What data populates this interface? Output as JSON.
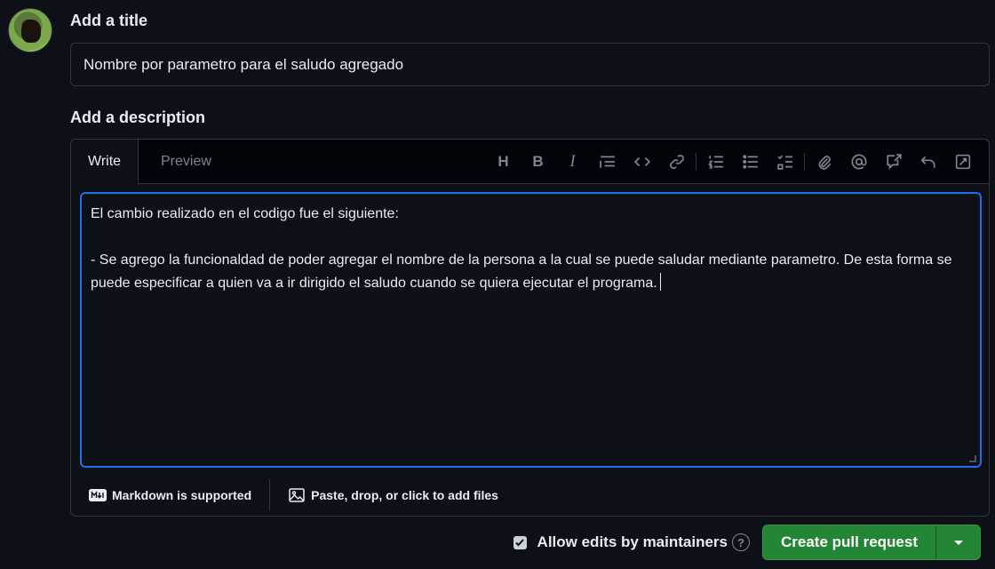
{
  "title_section": {
    "label": "Add a title",
    "value": "Nombre por parametro para el saludo agregado"
  },
  "description_section": {
    "label": "Add a description",
    "tabs": [
      {
        "label": "Write",
        "active": true
      },
      {
        "label": "Preview",
        "active": false
      }
    ],
    "toolbar": {
      "icons": [
        "heading-icon",
        "bold-icon",
        "italic-icon",
        "quote-icon",
        "code-icon",
        "link-icon",
        "ordered-list-icon",
        "unordered-list-icon",
        "task-list-icon",
        "attach-icon",
        "mention-icon",
        "reference-icon",
        "undo-icon",
        "fullscreen-icon"
      ],
      "heading_glyph": "H",
      "bold_glyph": "B",
      "italic_glyph": "I"
    },
    "body": "El cambio realizado en el codigo fue el siguiente:\n\n- Se agrego la funcionaldad de poder agregar el nombre de la persona a la cual se puede saludar mediante parametro. De esta forma se puede especificar a quien va a ir dirigido el saludo cuando se quiera ejecutar el programa.",
    "footer": {
      "markdown_label": "Markdown is supported",
      "attach_label": "Paste, drop, or click to add files"
    }
  },
  "actions": {
    "allow_edits_label": "Allow edits by maintainers",
    "allow_edits_checked": true,
    "help_glyph": "?",
    "create_label": "Create pull request"
  },
  "colors": {
    "background": "#0d1117",
    "accent_focus": "#1f6feb",
    "primary_button": "#238636"
  }
}
